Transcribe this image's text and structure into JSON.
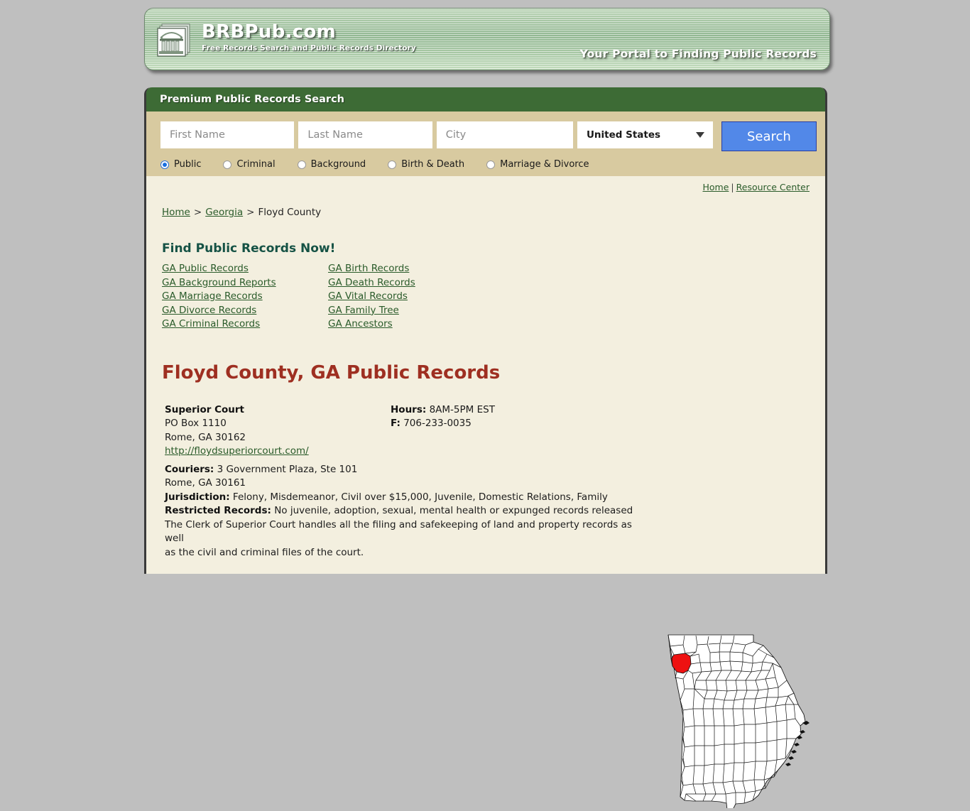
{
  "banner": {
    "brand": "BRBPub.com",
    "subtitle": "Free Records Search and Public Records Directory",
    "tagline": "Your Portal to Finding Public Records",
    "logo_icon": "courthouse-building-icon",
    "gradient_from": "#b9d3b4",
    "gradient_to": "#93b893"
  },
  "search": {
    "panel_title": "Premium Public Records Search",
    "first_name_placeholder": "First Name",
    "first_name_value": "",
    "last_name_placeholder": "Last Name",
    "last_name_value": "",
    "city_placeholder": "City",
    "city_value": "",
    "country_selected": "United States",
    "country_options": [
      "United States"
    ],
    "search_button": "Search",
    "button_color": "#5288e8",
    "header_color": "#3d6b35",
    "panel_color": "#d8caa0",
    "record_types": [
      {
        "label": "Public",
        "checked": true
      },
      {
        "label": "Criminal",
        "checked": false
      },
      {
        "label": "Background",
        "checked": false
      },
      {
        "label": "Birth & Death",
        "checked": false
      },
      {
        "label": "Marriage & Divorce",
        "checked": false
      }
    ]
  },
  "toplinks": {
    "home": "Home",
    "separator": "|",
    "resource_center": "Resource Center"
  },
  "breadcrumb": {
    "home": "Home",
    "sep1": ">",
    "state": "Georgia",
    "sep2": ">",
    "current": "Floyd County"
  },
  "find_records": {
    "heading": "Find Public Records Now!",
    "column_left": [
      "GA Public Records",
      "GA Background Reports",
      "GA Marriage Records",
      "GA Divorce Records",
      "GA Criminal Records"
    ],
    "column_right": [
      "GA Birth Records",
      "GA Death Records",
      "GA Vital Records",
      "GA Family Tree",
      "GA Ancestors"
    ]
  },
  "county": {
    "title": "Floyd County, GA Public Records",
    "title_color": "#9e2f21",
    "court_name": "Superior Court",
    "address_line1": "PO Box 1110",
    "address_line2": "Rome, GA 30162",
    "website": "http://floydsuperiorcourt.com/",
    "hours_label": "Hours:",
    "hours_value": "8AM-5PM EST",
    "fax_label": "F:",
    "fax_value": "706-233-0035",
    "couriers_label": "Couriers:",
    "couriers_value": "3 Government Plaza, Ste 101",
    "couriers_city": "Rome, GA 30161",
    "jurisdiction_label": "Jurisdiction:",
    "jurisdiction_value": "Felony, Misdemeanor, Civil over $15,000, Juvenile, Domestic Relations, Family",
    "restricted_label": "Restricted Records:",
    "restricted_value": "No juvenile, adoption, sexual, mental health or expunged records released",
    "note_line1": "The Clerk of Superior Court handles all the filing and safekeeping of land and property records as well",
    "note_line2": "as the civil and criminal files of the court."
  },
  "map": {
    "name": "georgia-county-map",
    "highlight_county": "Floyd County",
    "highlight_color": "#ee1111",
    "outline_color": "#000000",
    "fill_color": "#ffffff"
  }
}
